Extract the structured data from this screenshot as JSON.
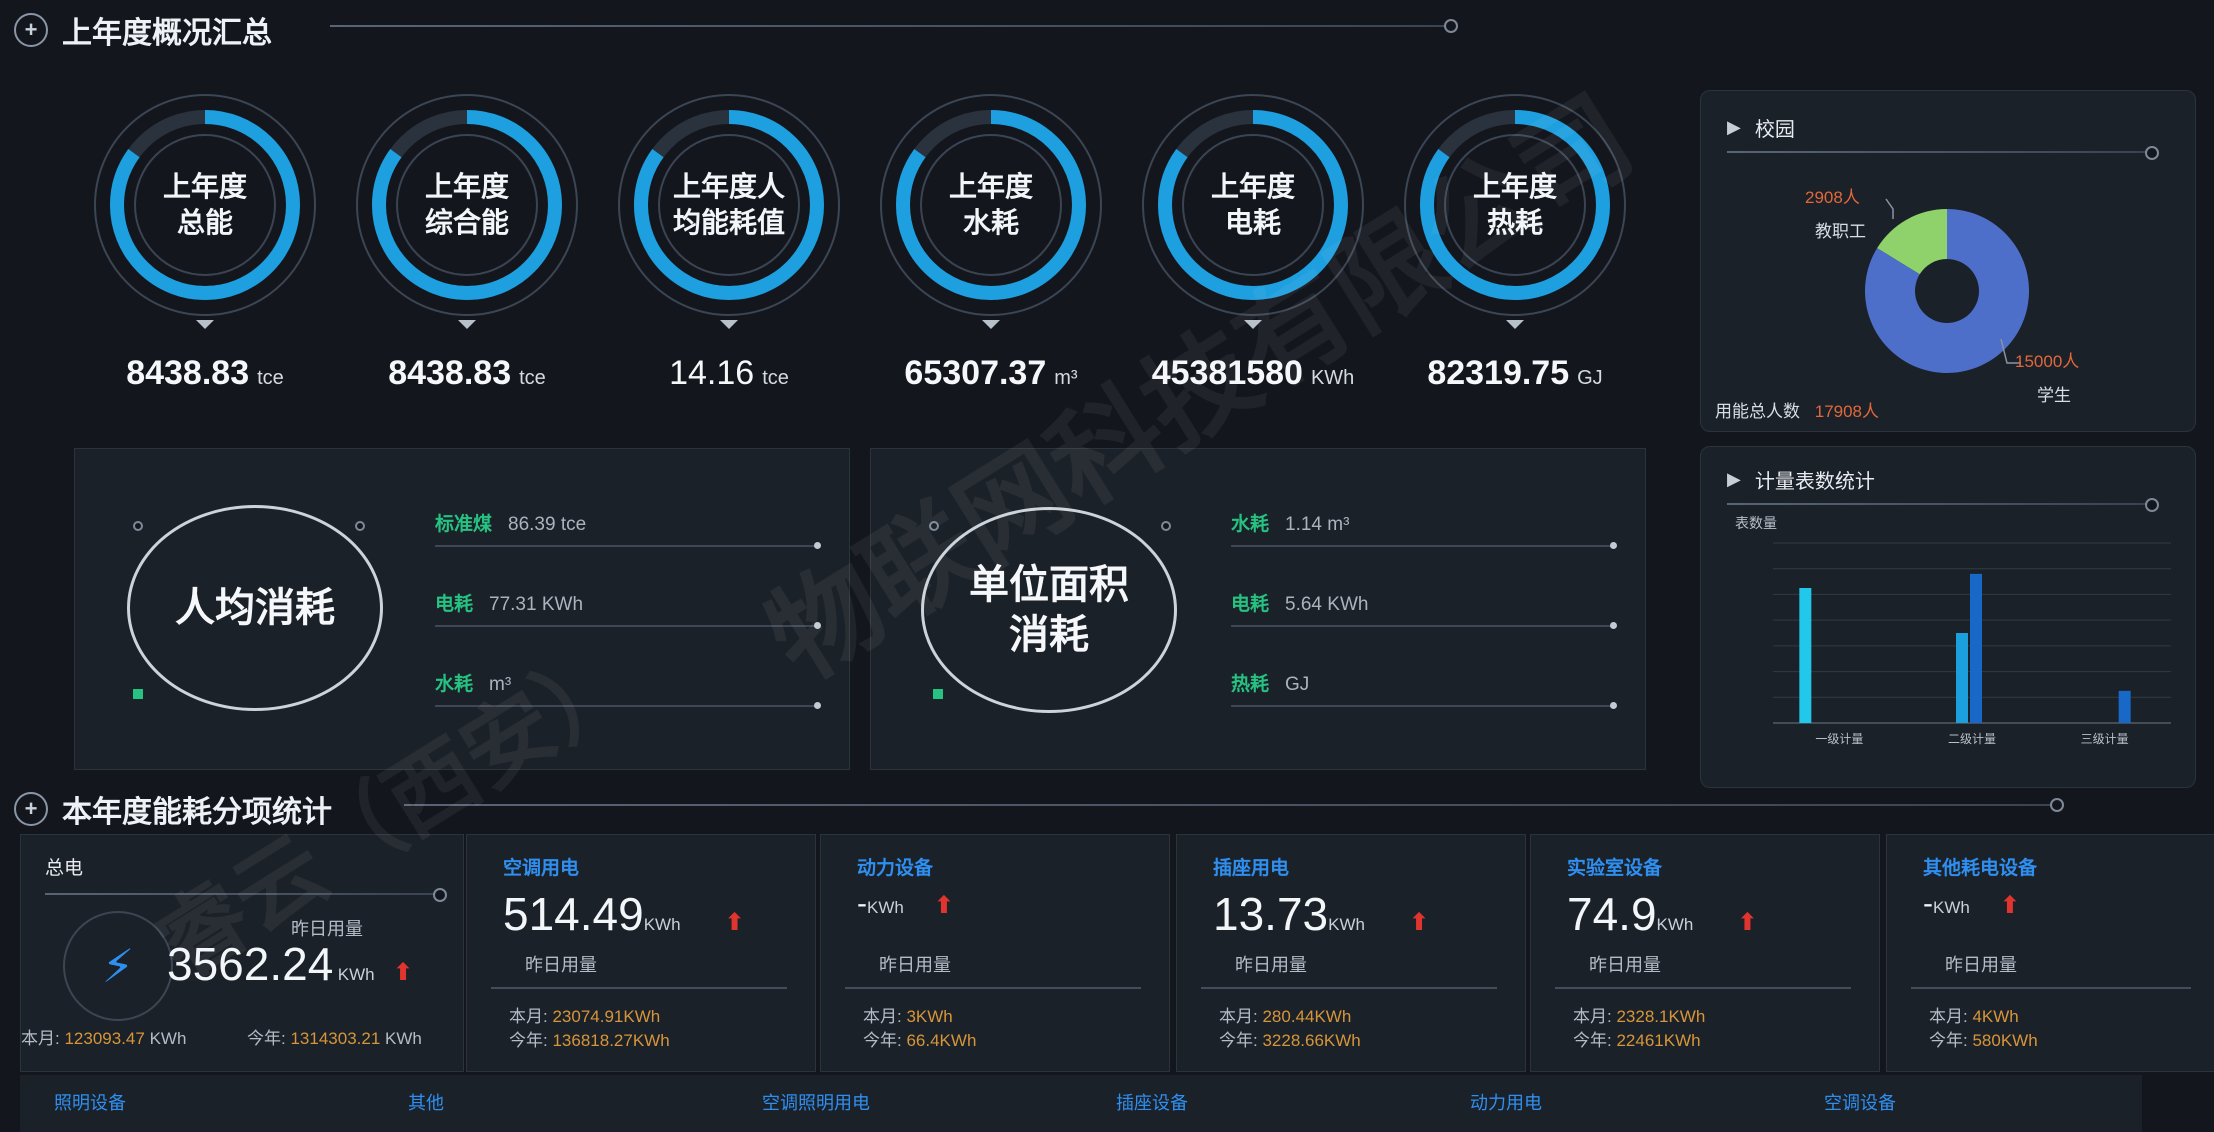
{
  "section1": {
    "title": "上年度概况汇总"
  },
  "rings": [
    {
      "label1": "上年度",
      "label2": "总能",
      "value": "8438.83",
      "unit": "tce",
      "fill": 0.85
    },
    {
      "label1": "上年度",
      "label2": "综合能",
      "value": "8438.83",
      "unit": "tce",
      "fill": 0.85
    },
    {
      "label1": "上年度人",
      "label2": "均能耗值",
      "value": "14.16",
      "unit": "tce",
      "fill": 0.85
    },
    {
      "label1": "上年度",
      "label2": "水耗",
      "value": "65307.37",
      "unit": "m³",
      "fill": 0.85
    },
    {
      "label1": "上年度",
      "label2": "电耗",
      "value": "45381580",
      "unit": "KWh",
      "fill": 0.85
    },
    {
      "label1": "上年度",
      "label2": "热耗",
      "value": "82319.75",
      "unit": "GJ",
      "fill": 0.85
    }
  ],
  "per_capita": {
    "title": "人均消耗",
    "rows": [
      {
        "k": "标准煤",
        "v": "86.39 tce"
      },
      {
        "k": "电耗",
        "v": "77.31 KWh"
      },
      {
        "k": "水耗",
        "v": "m³"
      }
    ]
  },
  "per_area": {
    "title1": "单位面积",
    "title2": "消耗",
    "rows": [
      {
        "k": "水耗",
        "v": "1.14 m³"
      },
      {
        "k": "电耗",
        "v": "5.64 KWh"
      },
      {
        "k": "热耗",
        "v": "GJ"
      }
    ]
  },
  "personnel": {
    "title": "校园",
    "staff_value": "2908人",
    "staff_label": "教职工",
    "student_value": "15000人",
    "student_label": "学生",
    "total_label": "用能总人数",
    "total_value": "17908人",
    "slices": [
      {
        "name": "教职工",
        "value": 2908,
        "color": "#8fd16a"
      },
      {
        "name": "学生",
        "value": 15000,
        "color": "#4d6fc9"
      }
    ]
  },
  "meters": {
    "title": "计量表数统计",
    "ylabel": "表数量",
    "chart_data": {
      "type": "bar",
      "categories": [
        "一级计量",
        "二级计量",
        "三级计量"
      ],
      "series": [
        {
          "values": [
            105000,
            0,
            0
          ],
          "color": "#22c8ea"
        },
        {
          "values": [
            0,
            70000,
            0
          ],
          "color": "#1c9fdd"
        },
        {
          "values": [
            0,
            116000,
            25000
          ],
          "color": "#1768c7"
        }
      ],
      "ylim": [
        0,
        140000
      ]
    }
  },
  "section2": {
    "title": "本年度能耗分项统计"
  },
  "total": {
    "title": "总电",
    "sub": "昨日用量",
    "value": "3562.24",
    "unit": "KWh",
    "month_label": "本月:",
    "month_value": "123093.47",
    "month_unit": "KWh",
    "year_label": "今年:",
    "year_value": "1314303.21",
    "year_unit": "KWh"
  },
  "cards": [
    {
      "title": "空调用电",
      "value": "514.49",
      "unit": "KWh",
      "sub": "昨日用量",
      "month_label": "本月:",
      "month": "23074.91KWh",
      "year_label": "今年:",
      "year": "136818.27KWh"
    },
    {
      "title": "动力设备",
      "value": "-",
      "unit": "KWh",
      "sub": "昨日用量",
      "month_label": "本月:",
      "month": "3KWh",
      "year_label": "今年:",
      "year": "66.4KWh"
    },
    {
      "title": "插座用电",
      "value": "13.73",
      "unit": "KWh",
      "sub": "昨日用量",
      "month_label": "本月:",
      "month": "280.44KWh",
      "year_label": "今年:",
      "year": "3228.66KWh"
    },
    {
      "title": "实验室设备",
      "value": "74.9",
      "unit": "KWh",
      "sub": "昨日用量",
      "month_label": "本月:",
      "month": "2328.1KWh",
      "year_label": "今年:",
      "year": "22461KWh"
    },
    {
      "title": "其他耗电设备",
      "value": "-",
      "unit": "KWh",
      "sub": "昨日用量",
      "month_label": "本月:",
      "month": "4KWh",
      "year_label": "今年:",
      "year": "580KWh"
    }
  ],
  "bottom_tabs": [
    "照明设备",
    "其他",
    "空调照明用电",
    "插座设备",
    "动力用电",
    "空调设备"
  ],
  "watermark": {
    "line1": "物联网科技有限公司",
    "line2": "睿云（西安）"
  }
}
